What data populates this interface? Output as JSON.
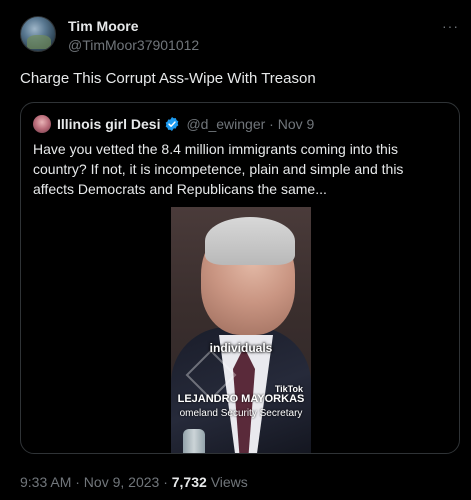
{
  "tweet": {
    "author_name": "Tim Moore",
    "author_handle": "@TimMoor37901012",
    "more_icon": "···",
    "text": "Charge This Corrupt Ass-Wipe With Treason",
    "timestamp": "9:33 AM · Nov 9, 2023 ·",
    "views_count": "7,732",
    "views_label": "Views"
  },
  "quote": {
    "author_name": "Illinois girl Desi",
    "verified": true,
    "author_handle": "@d_ewinger · Nov 9",
    "text": "Have you vetted the 8.4 million immigrants coming into this country? If not, it is incompetence, plain and simple and this affects Democrats and Republicans the same...",
    "media": {
      "caption": "individuals",
      "watermark": "TikTok",
      "name_overlay": "LEJANDRO MAYORKAS",
      "title_overlay": "omeland Security Secretary"
    }
  },
  "colors": {
    "background": "#000000",
    "text": "#e7e9ea",
    "muted": "#71767b",
    "border": "#2f3336",
    "verified": "#1d9bf0"
  }
}
